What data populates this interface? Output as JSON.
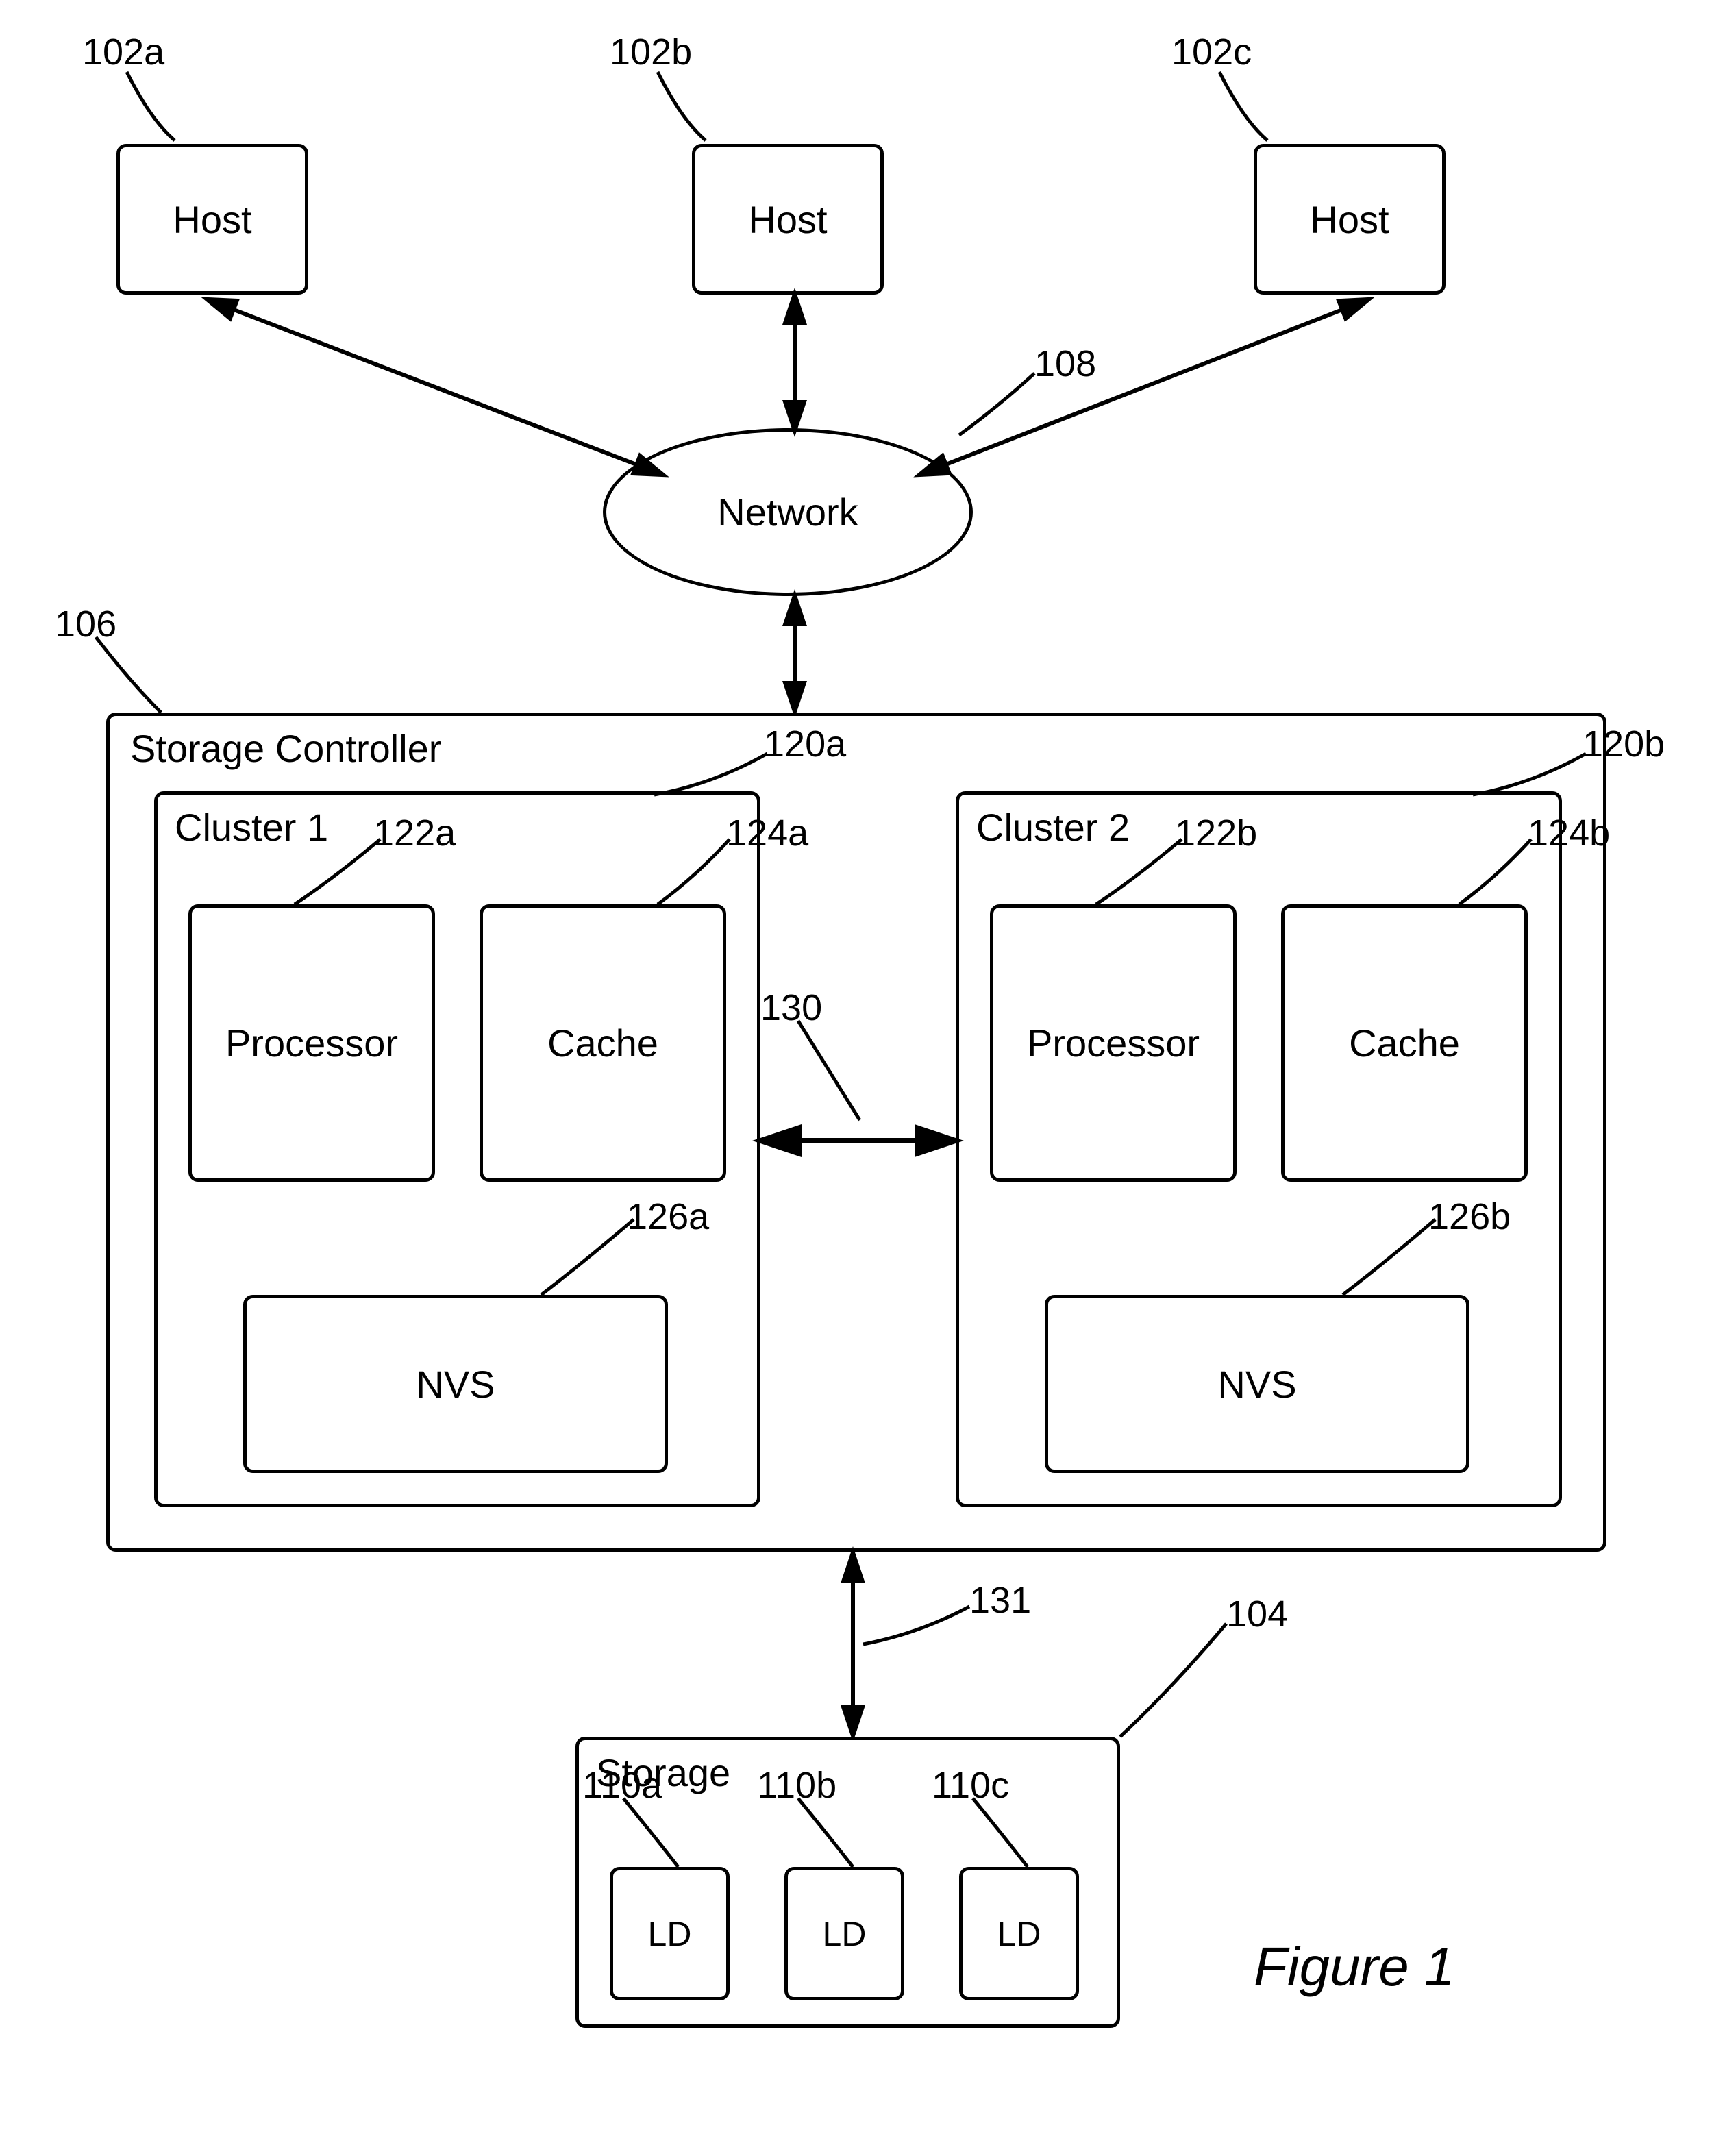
{
  "hosts": {
    "a": {
      "label": "Host",
      "ref": "102a"
    },
    "b": {
      "label": "Host",
      "ref": "102b"
    },
    "c": {
      "label": "Host",
      "ref": "102c"
    }
  },
  "network": {
    "label": "Network",
    "ref": "108"
  },
  "storage_controller": {
    "label": "Storage Controller",
    "ref": "106",
    "clusters": {
      "a": {
        "title": "Cluster 1",
        "ref": "120a",
        "processor": {
          "label": "Processor",
          "ref": "122a"
        },
        "cache": {
          "label": "Cache",
          "ref": "124a"
        },
        "nvs": {
          "label": "NVS",
          "ref": "126a"
        }
      },
      "b": {
        "title": "Cluster 2",
        "ref": "120b",
        "processor": {
          "label": "Processor",
          "ref": "122b"
        },
        "cache": {
          "label": "Cache",
          "ref": "124b"
        },
        "nvs": {
          "label": "NVS",
          "ref": "126b"
        }
      }
    },
    "bus": {
      "ref": "130",
      "to_storage_ref": "131"
    }
  },
  "storage": {
    "label": "Storage",
    "ref": "104",
    "drives": {
      "a": {
        "label": "LD",
        "ref": "110a"
      },
      "b": {
        "label": "LD",
        "ref": "110b"
      },
      "c": {
        "label": "LD",
        "ref": "110c"
      }
    }
  },
  "figure": "Figure 1"
}
